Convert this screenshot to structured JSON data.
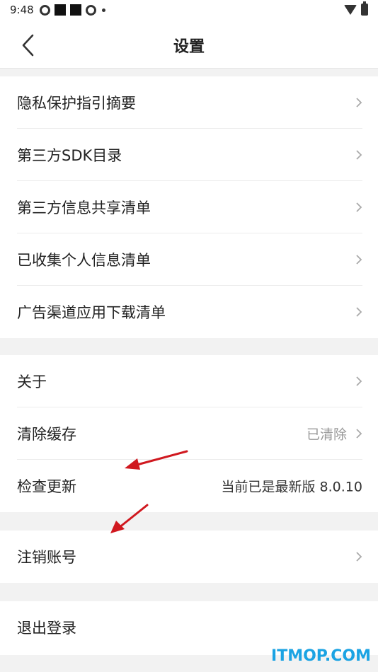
{
  "status_bar": {
    "time": "9:48"
  },
  "header": {
    "title": "设置",
    "back_icon": "chevron-left-icon"
  },
  "group1": {
    "items": [
      {
        "label": "隐私保护指引摘要"
      },
      {
        "label": "第三方SDK目录"
      },
      {
        "label": "第三方信息共享清单"
      },
      {
        "label": "已收集个人信息清单"
      },
      {
        "label": "广告渠道应用下载清单"
      }
    ]
  },
  "group2": {
    "items": [
      {
        "label": "关于"
      },
      {
        "label": "清除缓存",
        "value": "已清除"
      },
      {
        "label": "检查更新",
        "value": "当前已是最新版 8.0.10"
      }
    ]
  },
  "group3": {
    "items": [
      {
        "label": "注销账号"
      }
    ]
  },
  "group4": {
    "items": [
      {
        "label": "退出登录"
      }
    ]
  },
  "watermark": "ITMOP.COM",
  "colors": {
    "annotation_arrow": "#d0181f",
    "watermark": "#1ba3e3",
    "background": "#f2f2f2"
  }
}
